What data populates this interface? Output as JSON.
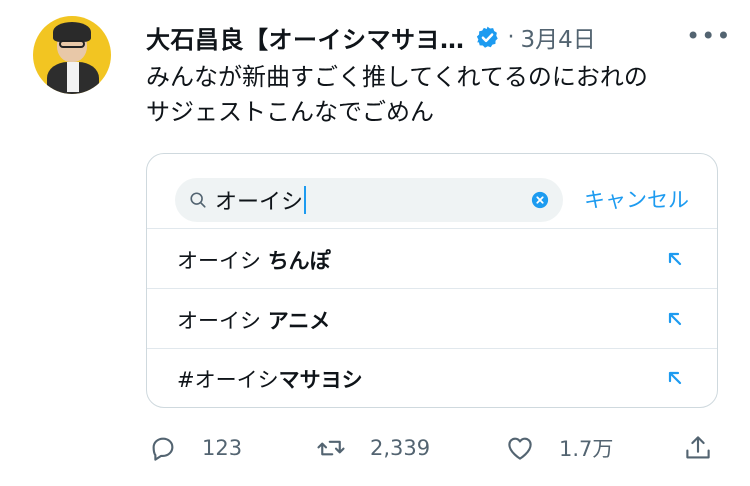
{
  "tweet": {
    "author_name": "大石昌良【オーイシマサヨ…",
    "date": "3月4日",
    "separator": "·",
    "more_label": "•••",
    "text_line1": "みんなが新曲すごく推してくれてるのにおれの",
    "text_line2": "サジェストこんなでごめん",
    "verified_icon": "verified-badge-icon",
    "accent_color": "#1d9bf0"
  },
  "search_card": {
    "search_value": "オーイシ",
    "cancel_label": "キャンセル",
    "suggestions": [
      {
        "prefix": "オーイシ ",
        "bold": "ちんぽ"
      },
      {
        "prefix": "オーイシ ",
        "bold": "アニメ"
      },
      {
        "prefix": "#オーイシ",
        "bold": "マサヨシ"
      }
    ]
  },
  "actions": {
    "reply_count": "123",
    "retweet_count": "2,339",
    "like_count": "1.7万"
  }
}
